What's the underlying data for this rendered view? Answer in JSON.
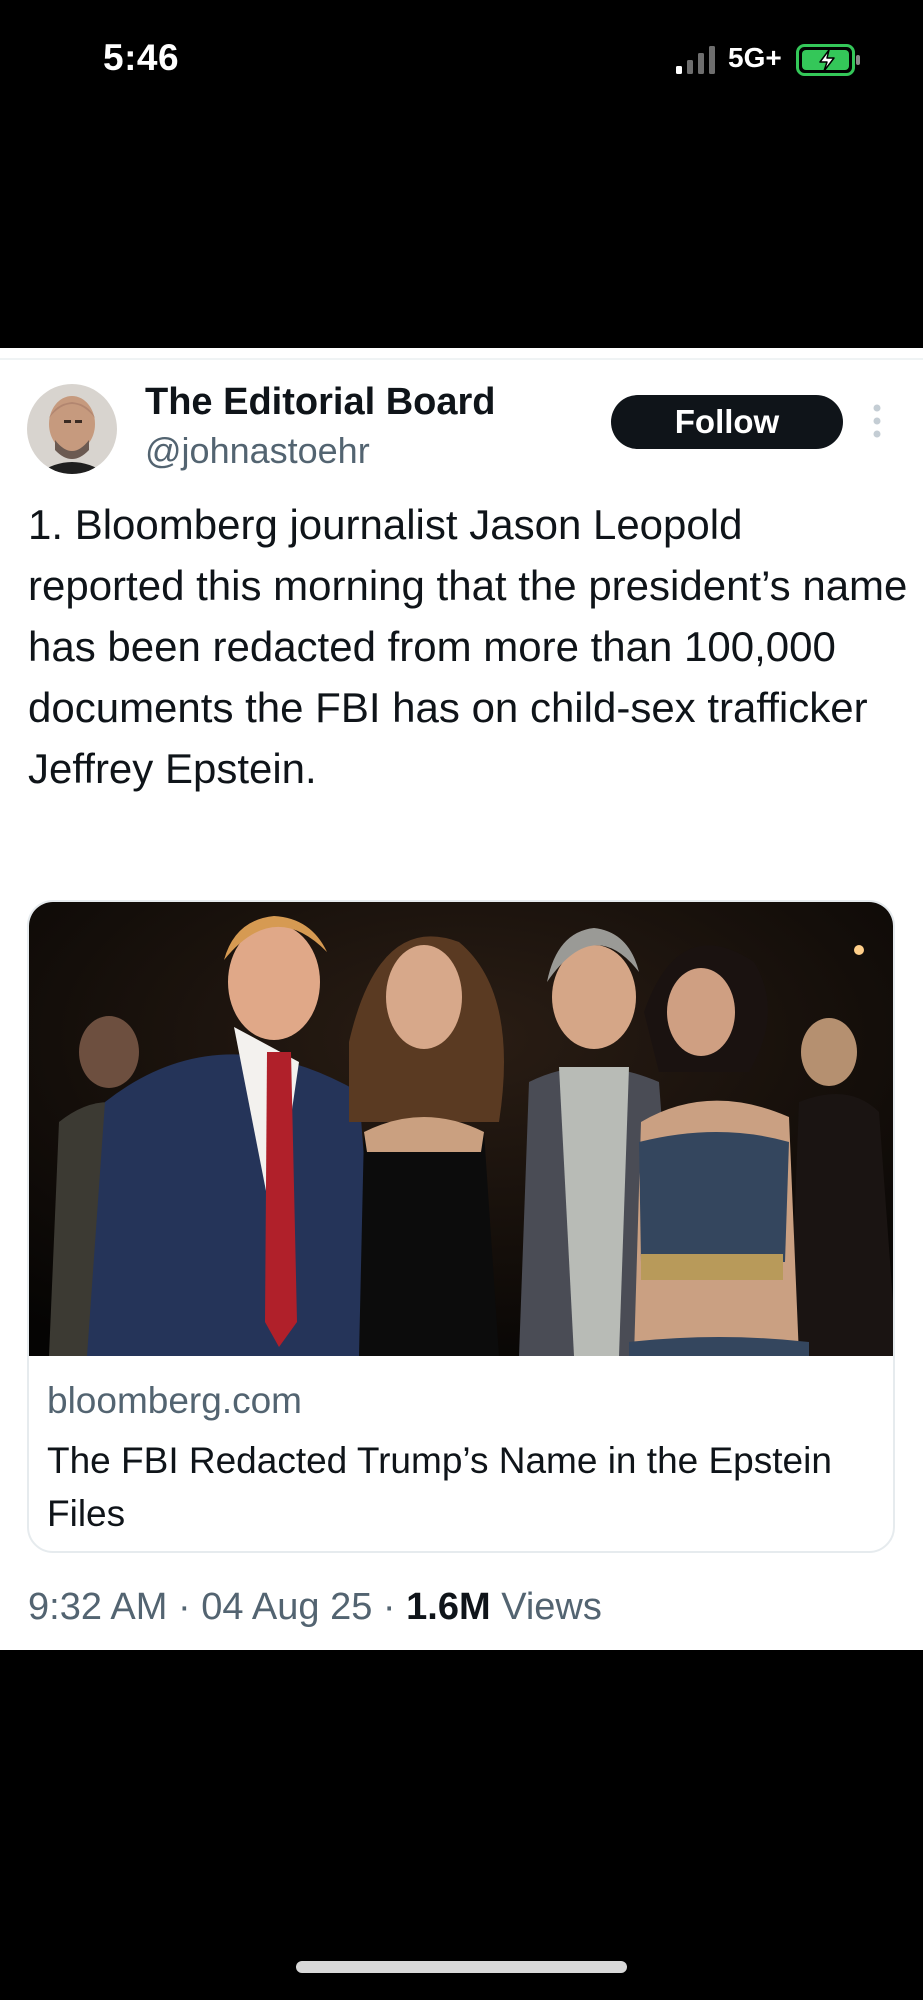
{
  "status_bar": {
    "time": "5:46",
    "network": "5G+",
    "signal_icon": "signal-bars-icon",
    "battery_icon": "battery-charging-icon",
    "battery_color": "#34c759"
  },
  "tweet": {
    "author": {
      "display_name": "The Editorial Board",
      "handle": "@johnastoehr",
      "avatar_icon": "avatar"
    },
    "follow_label": "Follow",
    "more_icon": "more-vertical-icon",
    "text": "1. Bloomberg journalist Jason Leopold reported this morning that the president’s name has been redacted from more than 100,000 documents the FBI has on child-sex trafficker Jeffrey Epstein.",
    "link_card": {
      "domain": "bloomberg.com",
      "title": "The FBI Redacted Trump’s Name in the Epstein Files"
    },
    "meta": {
      "time": "9:32 AM",
      "separator": " · ",
      "date": "04 Aug 25",
      "views_count": "1.6M",
      "views_label": " Views"
    }
  },
  "colors": {
    "text_primary": "#0f1419",
    "text_secondary": "#536471",
    "follow_bg": "#0f1419"
  }
}
